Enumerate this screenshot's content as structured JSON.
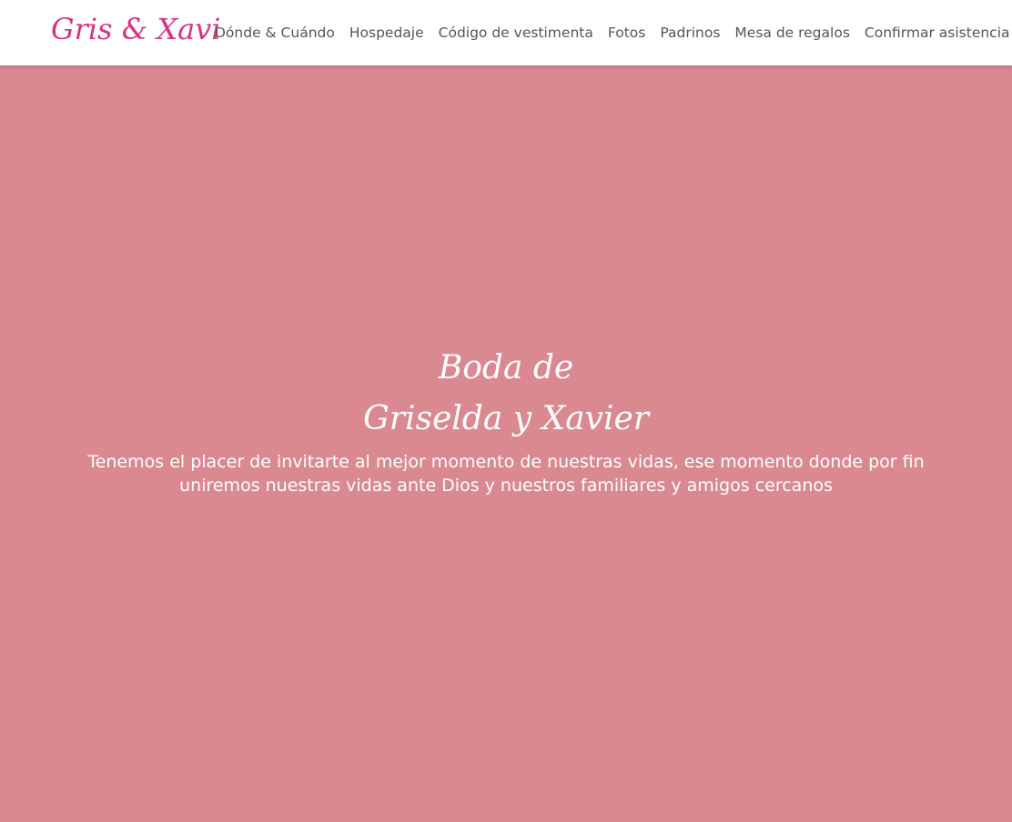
{
  "navbar": {
    "brand": "Gris & Xavi",
    "links": [
      {
        "label": "Dónde & Cuándo"
      },
      {
        "label": "Hospedaje"
      },
      {
        "label": "Código de vestimenta"
      },
      {
        "label": "Fotos"
      },
      {
        "label": "Padrinos"
      },
      {
        "label": "Mesa de regalos"
      },
      {
        "label": "Confirmar asistencia"
      }
    ]
  },
  "hero": {
    "title_line1": "Boda de",
    "title_line2": "Griselda y Xavier",
    "text": "Tenemos el placer de invitarte al mejor momento de nuestras vidas, ese momento donde por fin uniremos nuestras vidas ante Dios y nuestros familiares y amigos cercanos"
  },
  "colors": {
    "hero_background": "#db8991",
    "brand": "#d63384",
    "nav_text": "#555555",
    "hero_text": "#ffffff"
  }
}
